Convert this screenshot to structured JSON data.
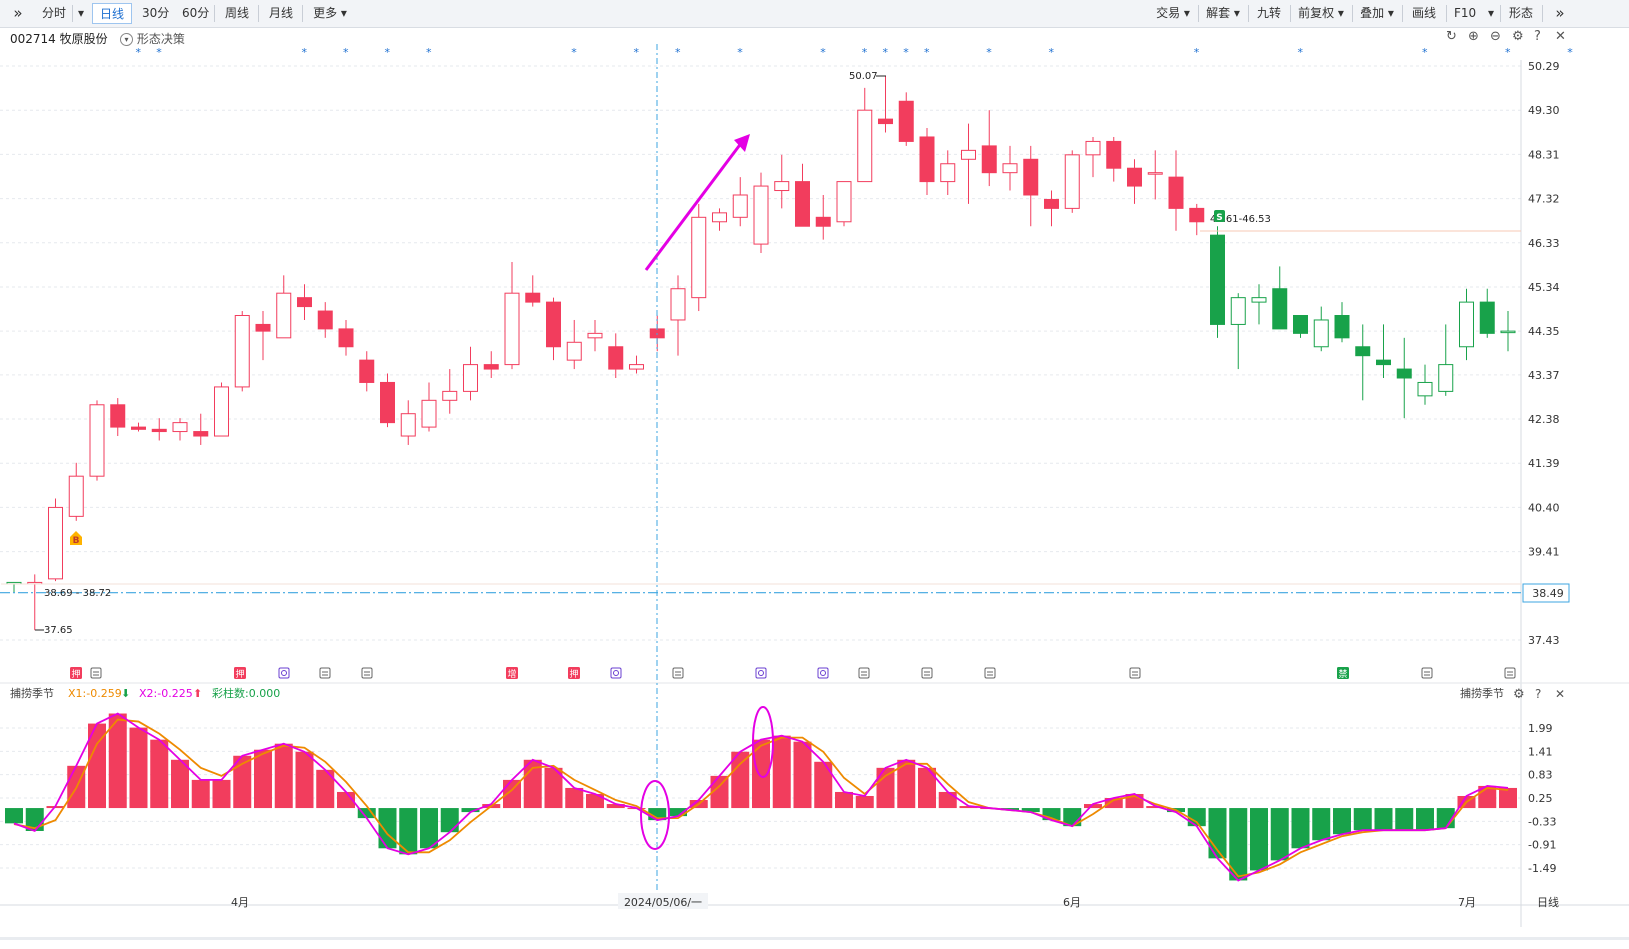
{
  "toolbar": {
    "expand_icon": "double-chevron-right-icon",
    "left_items": [
      "分时",
      "日线",
      "30分",
      "60分",
      "周线",
      "月线",
      "更多"
    ],
    "active": "日线",
    "right_items": [
      "交易",
      "解套",
      "九转",
      "前复权",
      "叠加",
      "画线",
      "F10",
      "形态"
    ],
    "right_icon": "double-chevron-right-icon"
  },
  "stock": {
    "title": "002714 牧原股份",
    "pattern_label": "形态决策"
  },
  "price_axis": {
    "ticks": [
      "50.29",
      "49.30",
      "48.31",
      "47.32",
      "46.33",
      "45.34",
      "44.35",
      "43.37",
      "42.38",
      "41.39",
      "40.40",
      "39.41",
      "38.49",
      "37.43"
    ],
    "current_price": "38.49"
  },
  "annotations": {
    "high_label": "50.07",
    "low_label": "37.65",
    "entry_label": "38.69 - 38.72",
    "exit_label": "46.61-46.53",
    "buy_marker": "B",
    "sell_marker": "S"
  },
  "indicator": {
    "name": "捕捞季节",
    "x1_label": "X1:",
    "x1_value": "-0.259",
    "x2_label": "X2:",
    "x2_value": "-0.225",
    "bar_count_label": "彩柱数:",
    "bar_count_value": "0.000",
    "right_name": "捕捞季节",
    "ticks": [
      "1.99",
      "1.41",
      "0.83",
      "0.25",
      "-0.33",
      "-0.91",
      "-1.49"
    ]
  },
  "date_axis": {
    "labels": [
      "4月",
      "2024/05/06/一",
      "6月",
      "7月"
    ],
    "period": "日线"
  },
  "event_badges": [
    "押",
    "押",
    "增",
    "押",
    "禁"
  ],
  "colors": {
    "up": "#f23d5d",
    "down": "#18a24a",
    "x1_line": "#e400e4",
    "x2_line": "#ee8a00",
    "accent": "#1d6fd0",
    "crosshair": "#3ea6e0"
  },
  "chart_data": {
    "type": "candlestick",
    "candles": [
      [
        38.72,
        38.72,
        38.5,
        38.72
      ],
      [
        38.7,
        38.9,
        37.65,
        38.72
      ],
      [
        38.8,
        40.6,
        38.75,
        40.4
      ],
      [
        40.2,
        41.4,
        40.1,
        41.1
      ],
      [
        41.1,
        42.8,
        41.0,
        42.7
      ],
      [
        42.7,
        42.85,
        42.0,
        42.2
      ],
      [
        42.2,
        42.3,
        42.1,
        42.15
      ],
      [
        42.15,
        42.4,
        41.9,
        42.1
      ],
      [
        42.1,
        42.4,
        41.9,
        42.3
      ],
      [
        42.1,
        42.5,
        41.8,
        42.0
      ],
      [
        42.0,
        43.2,
        42.0,
        43.1
      ],
      [
        43.1,
        44.8,
        43.0,
        44.7
      ],
      [
        44.5,
        44.8,
        43.7,
        44.35
      ],
      [
        44.2,
        45.6,
        44.2,
        45.2
      ],
      [
        45.1,
        45.4,
        44.6,
        44.9
      ],
      [
        44.8,
        45.0,
        44.2,
        44.4
      ],
      [
        44.4,
        44.6,
        43.8,
        44.0
      ],
      [
        43.7,
        43.9,
        43.0,
        43.2
      ],
      [
        43.2,
        43.4,
        42.2,
        42.3
      ],
      [
        42.0,
        42.8,
        41.8,
        42.5
      ],
      [
        42.2,
        43.2,
        42.1,
        42.8
      ],
      [
        42.8,
        43.5,
        42.5,
        43.0
      ],
      [
        43.0,
        44.0,
        42.8,
        43.6
      ],
      [
        43.6,
        43.9,
        43.3,
        43.5
      ],
      [
        43.6,
        45.9,
        43.5,
        45.2
      ],
      [
        45.2,
        45.6,
        44.9,
        45.0
      ],
      [
        45.0,
        45.1,
        43.7,
        44.0
      ],
      [
        43.7,
        44.6,
        43.5,
        44.1
      ],
      [
        44.2,
        44.6,
        43.9,
        44.3
      ],
      [
        44.0,
        44.3,
        43.3,
        43.5
      ],
      [
        43.5,
        43.8,
        43.4,
        43.6
      ],
      [
        44.4,
        44.7,
        43.9,
        44.2
      ],
      [
        44.6,
        45.6,
        43.8,
        45.3
      ],
      [
        45.1,
        47.2,
        44.8,
        46.9
      ],
      [
        46.8,
        47.1,
        46.6,
        47.0
      ],
      [
        46.9,
        47.8,
        46.7,
        47.4
      ],
      [
        46.3,
        47.9,
        46.1,
        47.6
      ],
      [
        47.5,
        48.3,
        47.1,
        47.7
      ],
      [
        47.7,
        48.1,
        46.7,
        46.7
      ],
      [
        46.9,
        47.4,
        46.4,
        46.7
      ],
      [
        46.8,
        47.7,
        46.7,
        47.7
      ],
      [
        47.7,
        49.8,
        47.7,
        49.3
      ],
      [
        49.1,
        50.07,
        48.8,
        49.0
      ],
      [
        49.5,
        49.7,
        48.5,
        48.6
      ],
      [
        48.7,
        48.9,
        47.4,
        47.7
      ],
      [
        47.7,
        48.4,
        47.4,
        48.1
      ],
      [
        48.2,
        49.0,
        47.2,
        48.4
      ],
      [
        48.5,
        49.3,
        47.6,
        47.9
      ],
      [
        47.9,
        48.5,
        47.5,
        48.1
      ],
      [
        48.2,
        48.5,
        46.7,
        47.4
      ],
      [
        47.3,
        47.5,
        46.7,
        47.1
      ],
      [
        47.1,
        48.4,
        47.0,
        48.3
      ],
      [
        48.3,
        48.7,
        47.8,
        48.6
      ],
      [
        48.6,
        48.7,
        47.7,
        48.0
      ],
      [
        48.0,
        48.2,
        47.2,
        47.6
      ],
      [
        47.9,
        48.4,
        47.3,
        47.9
      ],
      [
        47.8,
        48.4,
        46.6,
        47.1
      ],
      [
        47.1,
        47.2,
        46.5,
        46.8
      ],
      [
        46.5,
        46.7,
        44.2,
        44.5
      ],
      [
        44.5,
        45.2,
        43.5,
        45.1
      ],
      [
        45.0,
        45.4,
        44.5,
        45.1
      ],
      [
        45.3,
        45.8,
        44.4,
        44.4
      ],
      [
        44.7,
        44.7,
        44.2,
        44.3
      ],
      [
        44.0,
        44.9,
        43.9,
        44.6
      ],
      [
        44.7,
        45.0,
        44.1,
        44.2
      ],
      [
        44.0,
        44.5,
        42.8,
        43.8
      ],
      [
        43.7,
        44.5,
        43.3,
        43.6
      ],
      [
        43.5,
        44.2,
        42.4,
        43.3
      ],
      [
        42.9,
        43.6,
        42.7,
        43.2
      ],
      [
        43.0,
        44.5,
        42.9,
        43.6
      ],
      [
        44.0,
        45.3,
        43.7,
        45.0
      ],
      [
        45.0,
        45.3,
        44.2,
        44.3
      ],
      [
        44.35,
        44.8,
        43.9,
        44.35
      ]
    ],
    "x1": [
      -0.38,
      -0.57,
      0.05,
      1.05,
      2.1,
      2.35,
      2.0,
      1.7,
      1.2,
      0.7,
      0.7,
      1.3,
      1.45,
      1.6,
      1.4,
      0.95,
      0.4,
      -0.25,
      -1.0,
      -1.15,
      -1.0,
      -0.6,
      -0.1,
      0.1,
      0.7,
      1.2,
      1.0,
      0.5,
      0.35,
      0.1,
      0.0,
      -0.3,
      -0.2,
      0.2,
      0.8,
      1.4,
      1.7,
      1.8,
      1.65,
      1.15,
      0.4,
      0.3,
      1.0,
      1.2,
      1.0,
      0.4,
      0.05,
      0.0,
      -0.05,
      -0.1,
      -0.3,
      -0.45,
      0.1,
      0.25,
      0.35,
      0.05,
      -0.1,
      -0.45,
      -1.25,
      -1.8,
      -1.55,
      -1.3,
      -1.0,
      -0.8,
      -0.65,
      -0.55,
      -0.55,
      -0.55,
      -0.55,
      -0.5,
      0.3,
      0.55,
      0.5
    ],
    "x2": [
      -0.4,
      -0.5,
      -0.3,
      0.5,
      1.6,
      2.2,
      2.15,
      1.85,
      1.45,
      1.0,
      0.8,
      1.1,
      1.35,
      1.55,
      1.5,
      1.15,
      0.65,
      0.05,
      -0.65,
      -1.1,
      -1.1,
      -0.8,
      -0.35,
      0.05,
      0.45,
      1.0,
      1.05,
      0.7,
      0.45,
      0.2,
      0.05,
      -0.25,
      -0.25,
      0.1,
      0.55,
      1.1,
      1.55,
      1.75,
      1.75,
      1.4,
      0.75,
      0.35,
      0.8,
      1.1,
      1.1,
      0.6,
      0.15,
      0.0,
      -0.05,
      -0.1,
      -0.25,
      -0.45,
      -0.15,
      0.2,
      0.3,
      0.1,
      -0.05,
      -0.35,
      -1.05,
      -1.7,
      -1.6,
      -1.4,
      -1.1,
      -0.9,
      -0.7,
      -0.6,
      -0.55,
      -0.55,
      -0.55,
      -0.5,
      0.15,
      0.5,
      0.45
    ],
    "y_range": [
      37.2,
      50.6
    ],
    "indicator_range": [
      -1.95,
      2.45
    ]
  }
}
